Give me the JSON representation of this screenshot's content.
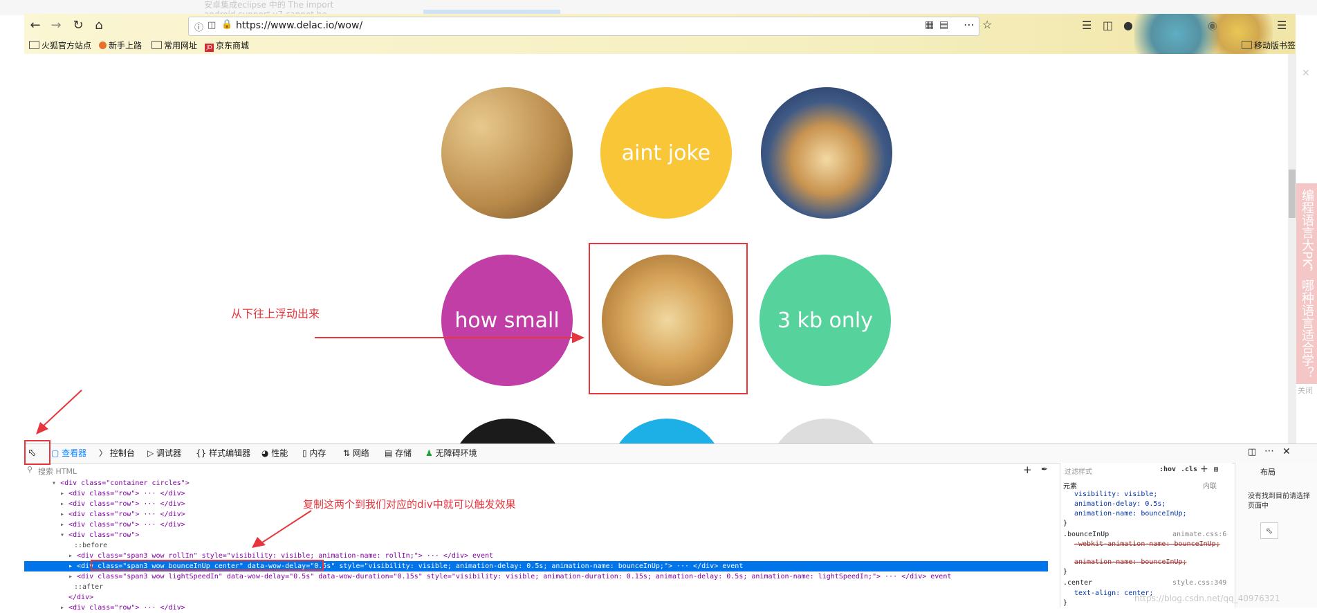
{
  "ghost_tab_text": "安卓集成eclipse 中的 The import\nandroid.support.v7 cannot be",
  "browser": {
    "url": "https://www.delac.io/wow/",
    "bookmarks": [
      "火狐官方站点",
      "新手上路",
      "常用网址",
      "京东商城"
    ],
    "mobile_bookmarks": "移动版书签"
  },
  "page": {
    "circles": [
      {
        "type": "image",
        "icon": "doge-faces-image"
      },
      {
        "type": "text",
        "text": "aint joke",
        "color": "#f9c638"
      },
      {
        "type": "image",
        "icon": "astronaut-doge-image"
      },
      {
        "type": "text",
        "text": "how small",
        "color": "#c23ea7"
      },
      {
        "type": "image",
        "icon": "sleepy-shiba-image"
      },
      {
        "type": "text",
        "text": "3 kb only",
        "color": "#56d39c"
      }
    ],
    "annotation_slide_up": "从下往上浮动出来",
    "annotation_copy": "复制这两个到我们对应的div中就可以触发效果",
    "side_banner": "编程语言大PK，哪种语言适合学？",
    "side_banner_close": "关闭"
  },
  "devtools": {
    "tabs": [
      "查看器",
      "控制台",
      "调试器",
      "样式编辑器",
      "性能",
      "内存",
      "网络",
      "存储",
      "无障碍环境"
    ],
    "search_placeholder": "搜索 HTML",
    "html_lines": [
      "<div class=\"container circles\">",
      "<div class=\"row\"> ··· </div>",
      "<div class=\"row\"> ··· </div>",
      "<div class=\"row\"> ··· </div>",
      "<div class=\"row\"> ··· </div>",
      "<div class=\"row\">",
      "::before",
      "<div class=\"span3 wow rollIn\" style=\"visibility: visible; animation-name: rollIn;\"> ··· </div> event",
      "<div class=\"span3 wow bounceInUp center\" data-wow-delay=\"0.5s\" style=\"visibility: visible; animation-delay: 0.5s; animation-name: bounceInUp;\"> ··· </div> event",
      "<div class=\"span3 wow lightSpeedIn\" data-wow-delay=\"0.5s\" data-wow-duration=\"0.15s\" style=\"visibility: visible; animation-duration: 0.15s; animation-delay: 0.5s; animation-name: lightSpeedIn;\"> ··· </div> event",
      "::after",
      "</div>",
      "<div class=\"row\"> ··· </div>"
    ],
    "rules": {
      "filter_placeholder": "过滤样式",
      "hov": ":hov",
      "cls": ".cls",
      "element_label": "元素",
      "inline_label": "内联",
      "element_props": [
        "visibility: visible;",
        "animation-delay: 0.5s;",
        "animation-name: bounceInUp;"
      ],
      "rule1_selector": ".bounceInUp",
      "rule1_source": "animate.css:6",
      "rule1_props": [
        "-webkit-animation-name: bounceInUp;",
        "animation-name: bounceInUp;"
      ],
      "rule2_selector": ".center",
      "rule2_source": "style.css:349",
      "rule2_props": [
        "text-align: center;"
      ]
    },
    "layout_tab": "布局",
    "layout_empty": "没有找到目前请选择页面中",
    "watermark": "https://blog.csdn.net/qq_40976321"
  }
}
